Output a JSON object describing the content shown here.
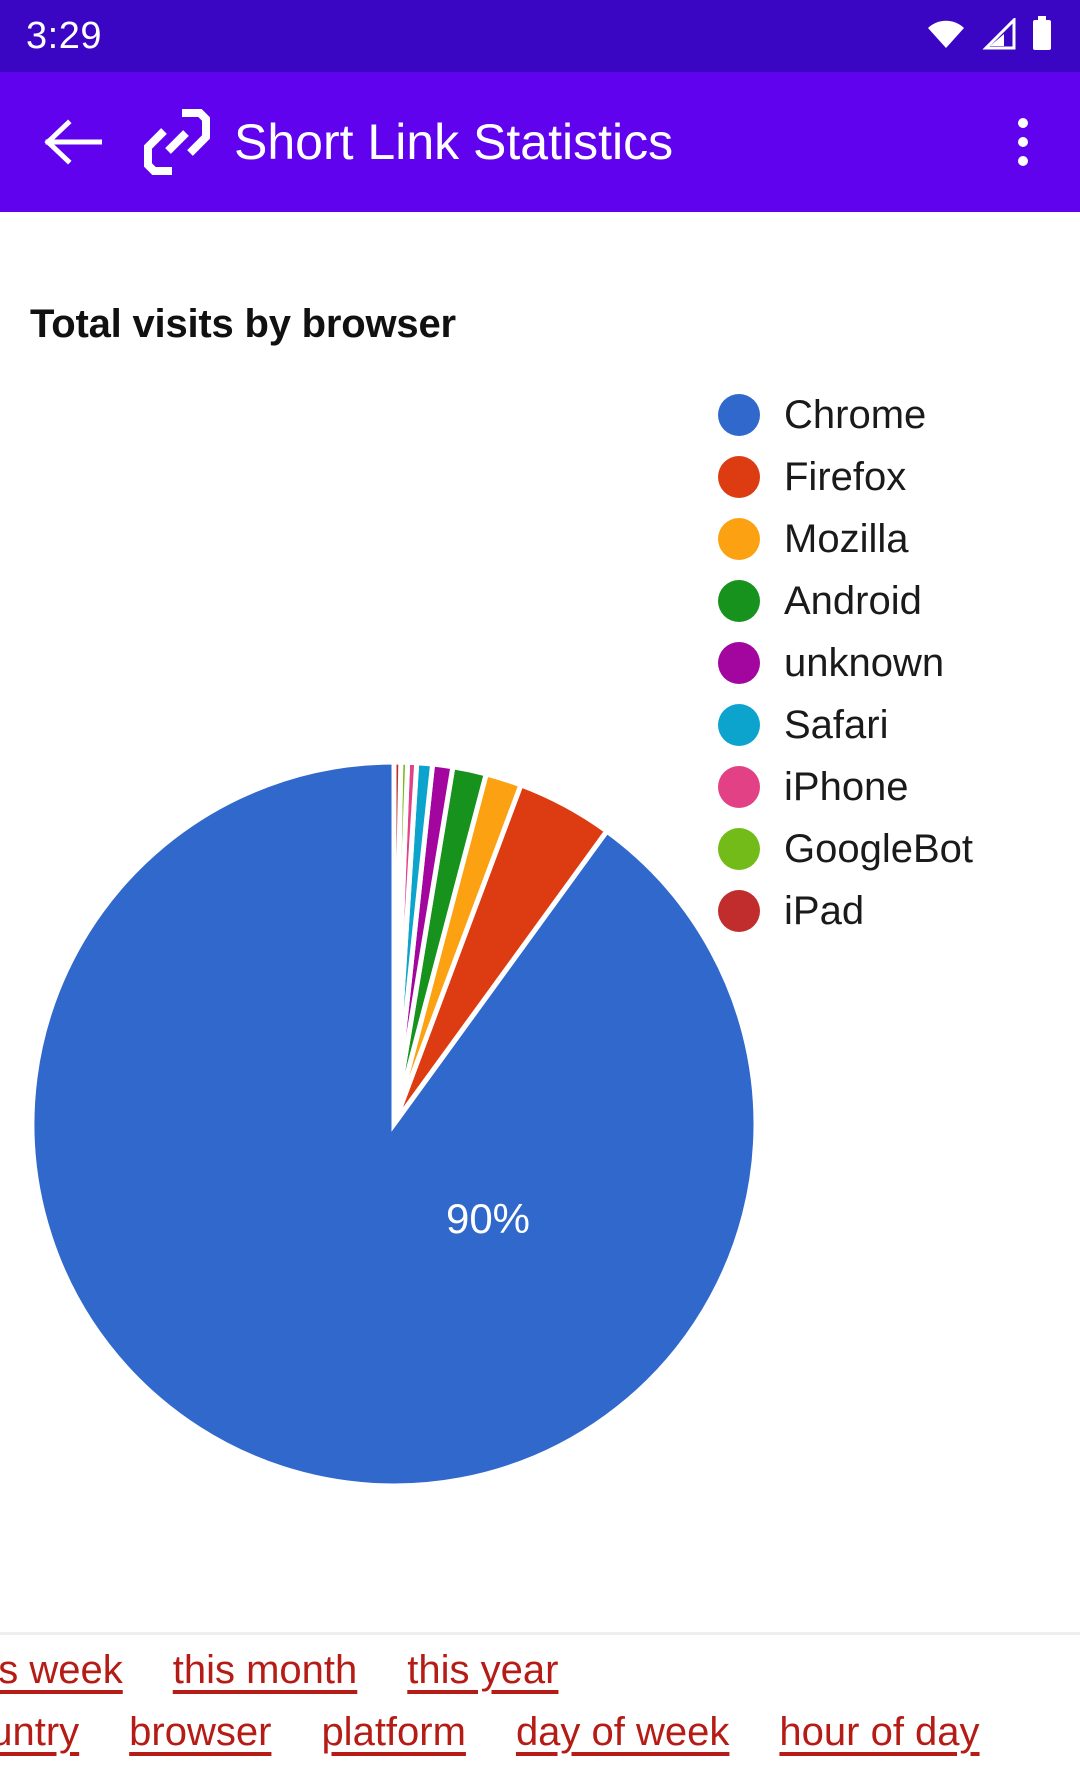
{
  "status_bar": {
    "time": "3:29",
    "icons": [
      "wifi-icon",
      "cellular-signal-icon",
      "battery-icon"
    ],
    "background": "#3A06C4"
  },
  "app_bar": {
    "back_label": "Back",
    "brand_icon": "link-chain-icon",
    "title": "Short Link Statistics",
    "overflow_label": "More options",
    "background": "#6002EE"
  },
  "main": {
    "chart_title": "Total visits by browser"
  },
  "chart_data": {
    "type": "pie",
    "title": "Total visits by browser",
    "legend_position": "right",
    "labels": [
      "Chrome",
      "Firefox",
      "Mozilla",
      "Android",
      "unknown",
      "Safari",
      "iPhone",
      "GoogleBot",
      "iPad"
    ],
    "colors": [
      "#3068CC",
      "#DD3B11",
      "#FCA212",
      "#17921D",
      "#A2069F",
      "#0CA4CD",
      "#E34185",
      "#73BB19",
      "#C12C2C"
    ],
    "percentages": [
      90.0,
      4.3,
      1.6,
      1.5,
      0.9,
      0.7,
      0.4,
      0.3,
      0.3
    ],
    "values": [
      90.0,
      4.3,
      1.6,
      1.5,
      0.9,
      0.7,
      0.4,
      0.3,
      0.3
    ],
    "data_labels": [
      {
        "series": "Chrome",
        "text": "90%",
        "x": 488,
        "y": 1219
      }
    ],
    "start_angle_deg": 0,
    "direction": "counterclockwise",
    "center": {
      "x": 394,
      "y": 912
    },
    "radius": 362
  },
  "legend": {
    "items": [
      {
        "label": "Chrome",
        "color": "#3068CC"
      },
      {
        "label": "Firefox",
        "color": "#DD3B11"
      },
      {
        "label": "Mozilla",
        "color": "#FCA212"
      },
      {
        "label": "Android",
        "color": "#17921D"
      },
      {
        "label": "unknown",
        "color": "#A2069F"
      },
      {
        "label": "Safari",
        "color": "#0CA4CD"
      },
      {
        "label": "iPhone",
        "color": "#E34185"
      },
      {
        "label": "GoogleBot",
        "color": "#73BB19"
      },
      {
        "label": "iPad",
        "color": "#C12C2C"
      }
    ]
  },
  "bottom_nav": {
    "link_color": "#B51C15",
    "row1": [
      "this week",
      "this month",
      "this year"
    ],
    "row2": [
      "country",
      "browser",
      "platform",
      "day of week",
      "hour of day"
    ]
  }
}
